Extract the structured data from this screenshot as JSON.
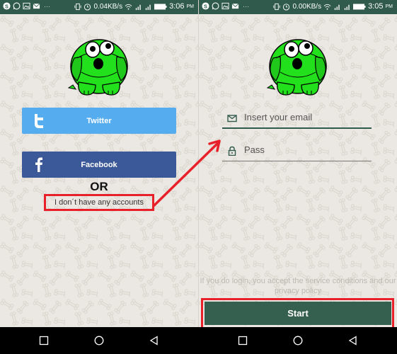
{
  "screens": {
    "left": {
      "status_bar": {
        "notification_icons": [
          "skype-icon",
          "whatsapp-icon",
          "image-icon",
          "mail-icon"
        ],
        "more": "···",
        "speed": "0.04KB/s",
        "time": "3:06",
        "ampm": "PM"
      },
      "twitter_label": "Twitter",
      "facebook_label": "Facebook",
      "or_label": "OR",
      "no_account_label": "I don´t have any accounts"
    },
    "right": {
      "status_bar": {
        "notification_icons": [
          "skype-icon",
          "whatsapp-icon",
          "image-icon",
          "mail-icon"
        ],
        "more": "···",
        "speed": "0.00KB/s",
        "time": "3:05",
        "ampm": "PM"
      },
      "email_placeholder": "Insert your email",
      "pass_placeholder": "Pass",
      "terms_text": "If you do login, you accept the service conditions and our privacy policy",
      "start_label": "Start"
    }
  },
  "colors": {
    "status_bar": "#2f5a4c",
    "twitter": "#55acee",
    "facebook": "#3b5898",
    "start_button": "#35604f",
    "annotation": "#e8202a",
    "dog_green": "#22e01c"
  }
}
